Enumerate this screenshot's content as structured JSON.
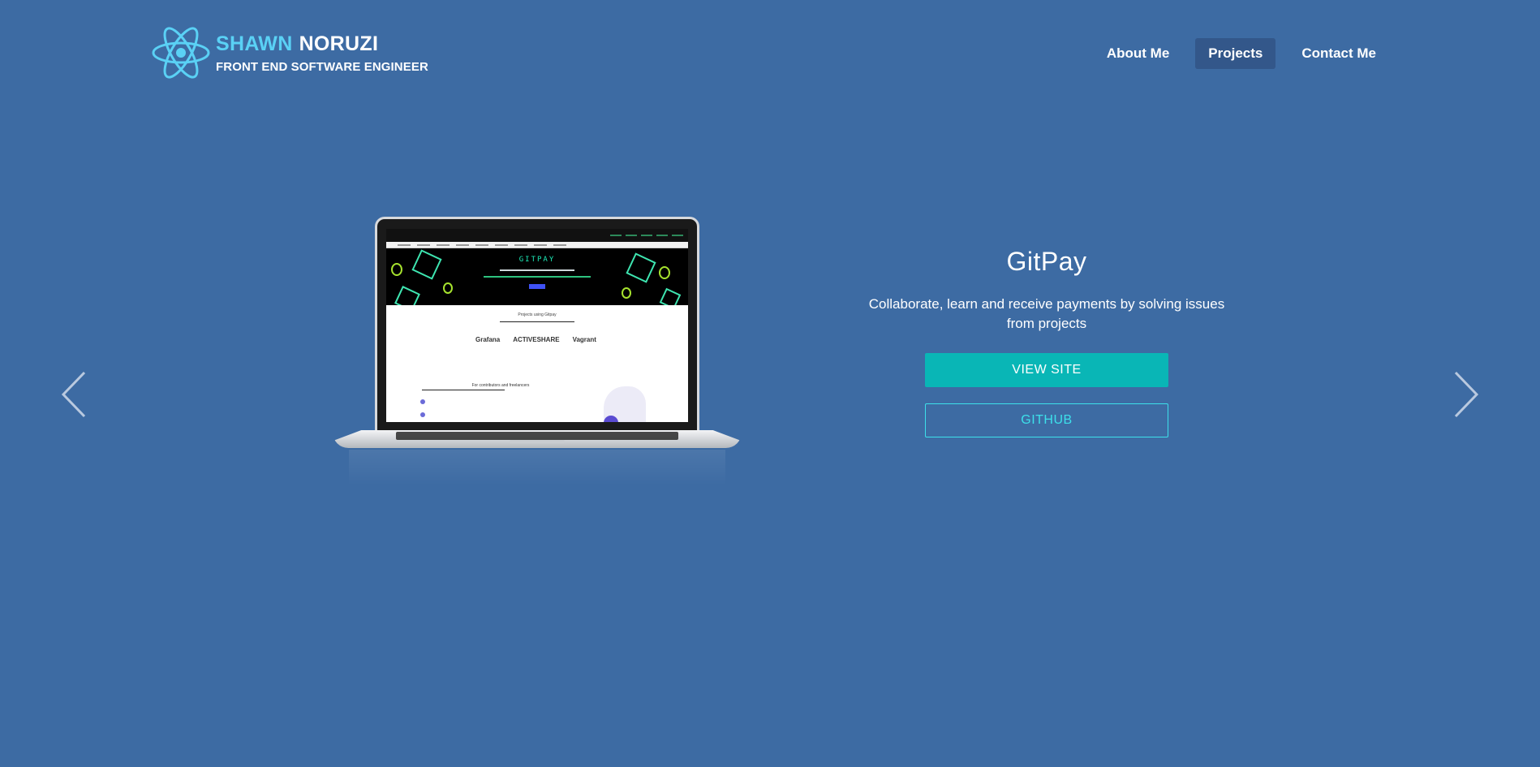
{
  "header": {
    "brand_first": "SHAWN",
    "brand_last": "NORUZI",
    "brand_subtitle": "FRONT END SOFTWARE ENGINEER",
    "logo_icon": "atom-icon"
  },
  "nav": {
    "items": [
      {
        "label": "About Me",
        "active": false
      },
      {
        "label": "Projects",
        "active": true
      },
      {
        "label": "Contact Me",
        "active": false
      }
    ]
  },
  "carousel": {
    "prev_icon": "chevron-left-icon",
    "next_icon": "chevron-right-icon"
  },
  "project": {
    "title": "GitPay",
    "description": "Collaborate, learn and receive payments by solving issues from projects",
    "view_label": "VIEW SITE",
    "github_label": "GITHUB"
  },
  "screenshot": {
    "hero_title": "GITPAY",
    "projects_heading": "Projects using Gitpay",
    "logos": [
      "Grafana",
      "ACTIVESHARE",
      "Vagrant"
    ],
    "contributors_heading": "For contributors and freelancers"
  },
  "colors": {
    "background": "#3d6ba3",
    "accent_cyan": "#5ad1f5",
    "button_teal": "#09b6b6",
    "outline_cyan": "#3de0ea",
    "nav_active": "#33578a"
  }
}
